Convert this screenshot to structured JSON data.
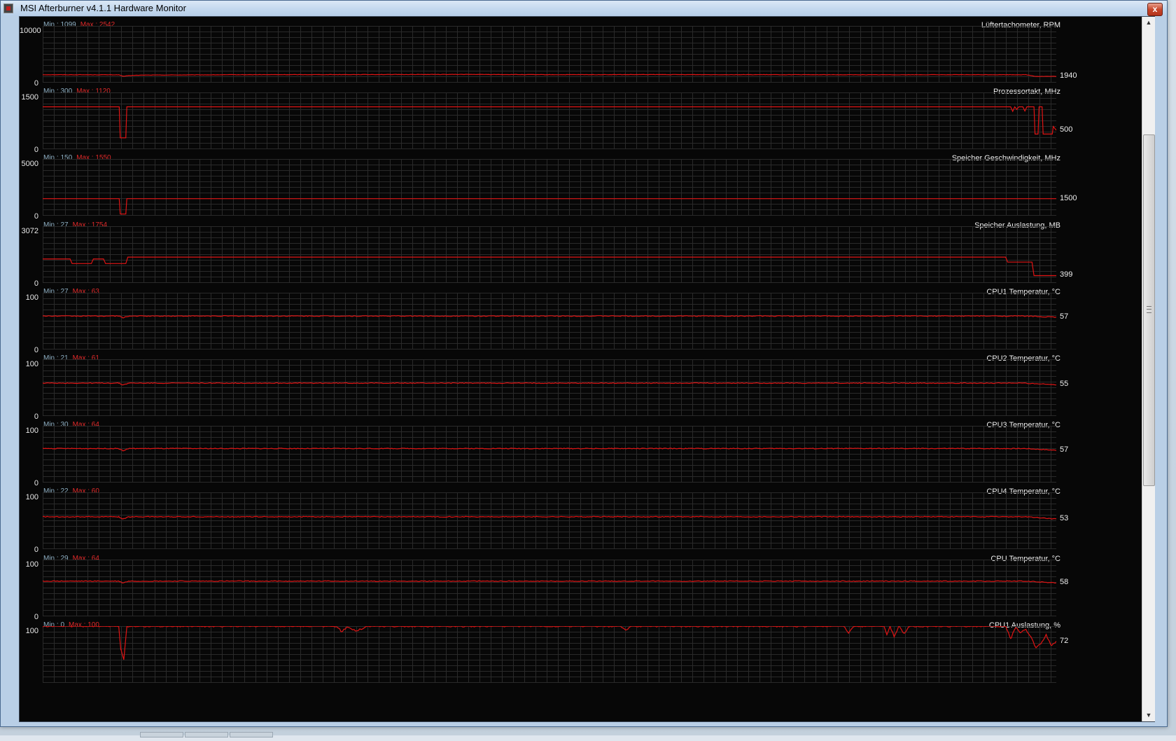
{
  "window": {
    "title": "MSI Afterburner v4.1.1 Hardware Monitor",
    "close_label": "x"
  },
  "colors": {
    "graph_line": "#e01414",
    "grid": "#2a2a2a",
    "background": "#070707",
    "min_text": "#8fb0c4",
    "max_text": "#e02a2a"
  },
  "scrollbar": {
    "up_glyph": "▲",
    "down_glyph": "▼"
  },
  "graphs": [
    {
      "label": "Lüftertachometer, RPM",
      "min_text": "Min : 1099",
      "max_text": "Max : 2542",
      "y_top": "10000",
      "y_bottom": "0",
      "y_max": 10000,
      "current": "1940",
      "samples": [
        [
          0,
          1400
        ],
        [
          0.075,
          1380
        ],
        [
          0.08,
          1100
        ],
        [
          0.085,
          1250
        ],
        [
          0.1,
          1330
        ],
        [
          0.2,
          1400
        ],
        [
          0.42,
          1450
        ],
        [
          0.5,
          1400
        ],
        [
          0.6,
          1420
        ],
        [
          0.8,
          1390
        ],
        [
          0.97,
          1400
        ],
        [
          0.98,
          1100
        ],
        [
          1,
          1100
        ]
      ],
      "noise": 30
    },
    {
      "label": "Prozessortakt, MHz",
      "min_text": "Min : 300",
      "max_text": "Max : 1120",
      "y_top": "1500",
      "y_bottom": "0",
      "y_max": 1500,
      "current": "500",
      "samples": [
        [
          0,
          1120
        ],
        [
          0.0755,
          1120
        ],
        [
          0.0765,
          300
        ],
        [
          0.082,
          300
        ],
        [
          0.083,
          1120
        ],
        [
          0.955,
          1120
        ],
        [
          0.957,
          1000
        ],
        [
          0.959,
          1120
        ],
        [
          0.961,
          1050
        ],
        [
          0.963,
          1120
        ],
        [
          0.967,
          1120
        ],
        [
          0.969,
          1010
        ],
        [
          0.971,
          1120
        ],
        [
          0.978,
          1120
        ],
        [
          0.979,
          400
        ],
        [
          0.982,
          400
        ],
        [
          0.983,
          1120
        ],
        [
          0.986,
          1120
        ],
        [
          0.987,
          400
        ],
        [
          0.996,
          400
        ],
        [
          0.997,
          600
        ],
        [
          1,
          500
        ]
      ],
      "noise": 0
    },
    {
      "label": "Speicher Geschwindigkeit, MHz",
      "min_text": "Min : 150",
      "max_text": "Max : 1550",
      "y_top": "5000",
      "y_bottom": "0",
      "y_max": 5000,
      "current": "1500",
      "samples": [
        [
          0,
          1500
        ],
        [
          0.0755,
          1500
        ],
        [
          0.0765,
          150
        ],
        [
          0.082,
          150
        ],
        [
          0.083,
          1500
        ],
        [
          1,
          1500
        ]
      ],
      "noise": 0
    },
    {
      "label": "Speicher Auslastung, MB",
      "min_text": "Min : 27",
      "max_text": "Max : 1754",
      "y_top": "3072",
      "y_bottom": "0",
      "y_max": 3072,
      "current": "399",
      "samples": [
        [
          0,
          1300
        ],
        [
          0.027,
          1300
        ],
        [
          0.029,
          1050
        ],
        [
          0.048,
          1050
        ],
        [
          0.05,
          1300
        ],
        [
          0.06,
          1300
        ],
        [
          0.062,
          1050
        ],
        [
          0.082,
          1050
        ],
        [
          0.084,
          1400
        ],
        [
          0.95,
          1400
        ],
        [
          0.952,
          1130
        ],
        [
          0.976,
          1130
        ],
        [
          0.978,
          399
        ],
        [
          1,
          399
        ]
      ],
      "noise": 0
    },
    {
      "label": "CPU1 Temperatur, °C",
      "min_text": "Min : 27",
      "max_text": "Max : 63",
      "y_top": "100",
      "y_bottom": "0",
      "y_max": 100,
      "current": "57",
      "samples": [
        [
          0,
          59
        ],
        [
          0.075,
          59
        ],
        [
          0.079,
          56
        ],
        [
          0.085,
          59
        ],
        [
          0.5,
          59
        ],
        [
          0.97,
          59
        ],
        [
          1,
          57
        ]
      ],
      "noise": 0.7
    },
    {
      "label": "CPU2 Temperatur, °C",
      "min_text": "Min : 21",
      "max_text": "Max : 61",
      "y_top": "100",
      "y_bottom": "0",
      "y_max": 100,
      "current": "55",
      "samples": [
        [
          0,
          58
        ],
        [
          0.075,
          58
        ],
        [
          0.079,
          55
        ],
        [
          0.085,
          58
        ],
        [
          0.5,
          58
        ],
        [
          0.97,
          58
        ],
        [
          1,
          55
        ]
      ],
      "noise": 0.7
    },
    {
      "label": "CPU3 Temperatur, °C",
      "min_text": "Min : 30",
      "max_text": "Max : 64",
      "y_top": "100",
      "y_bottom": "0",
      "y_max": 100,
      "current": "57",
      "samples": [
        [
          0,
          60
        ],
        [
          0.075,
          60
        ],
        [
          0.079,
          56
        ],
        [
          0.085,
          60
        ],
        [
          0.5,
          60
        ],
        [
          0.97,
          60
        ],
        [
          1,
          57
        ]
      ],
      "noise": 0.7
    },
    {
      "label": "CPU4 Temperatur, °C",
      "min_text": "Min : 22",
      "max_text": "Max : 60",
      "y_top": "100",
      "y_bottom": "0",
      "y_max": 100,
      "current": "53",
      "samples": [
        [
          0,
          57
        ],
        [
          0.075,
          57
        ],
        [
          0.079,
          53
        ],
        [
          0.085,
          57
        ],
        [
          0.5,
          57
        ],
        [
          0.97,
          57
        ],
        [
          1,
          53
        ]
      ],
      "noise": 0.7
    },
    {
      "label": "CPU Temperatur, °C",
      "min_text": "Min : 29",
      "max_text": "Max : 64",
      "y_top": "100",
      "y_bottom": "0",
      "y_max": 100,
      "current": "58",
      "samples": [
        [
          0,
          62
        ],
        [
          0.075,
          62
        ],
        [
          0.079,
          59
        ],
        [
          0.085,
          62
        ],
        [
          0.5,
          62
        ],
        [
          0.97,
          62
        ],
        [
          1,
          59
        ]
      ],
      "noise": 0.7
    },
    {
      "label": "CPU1 Auslastung, %",
      "min_text": "Min : 0",
      "max_text": "Max : 100",
      "y_top": "100",
      "y_bottom": "",
      "y_max": 100,
      "current": "72",
      "samples": [
        [
          0,
          100
        ],
        [
          0.075,
          100
        ],
        [
          0.077,
          60
        ],
        [
          0.08,
          40
        ],
        [
          0.083,
          100
        ],
        [
          0.29,
          100
        ],
        [
          0.295,
          90
        ],
        [
          0.3,
          98
        ],
        [
          0.31,
          92
        ],
        [
          0.32,
          100
        ],
        [
          0.57,
          100
        ],
        [
          0.575,
          92
        ],
        [
          0.58,
          100
        ],
        [
          0.79,
          100
        ],
        [
          0.795,
          88
        ],
        [
          0.8,
          100
        ],
        [
          0.83,
          100
        ],
        [
          0.833,
          85
        ],
        [
          0.836,
          100
        ],
        [
          0.84,
          82
        ],
        [
          0.845,
          100
        ],
        [
          0.85,
          86
        ],
        [
          0.855,
          100
        ],
        [
          0.95,
          100
        ],
        [
          0.955,
          78
        ],
        [
          0.96,
          98
        ],
        [
          0.965,
          88
        ],
        [
          0.97,
          95
        ],
        [
          0.975,
          80
        ],
        [
          0.98,
          62
        ],
        [
          0.985,
          70
        ],
        [
          0.99,
          85
        ],
        [
          0.995,
          65
        ],
        [
          1,
          72
        ]
      ],
      "noise": 1.5
    }
  ]
}
